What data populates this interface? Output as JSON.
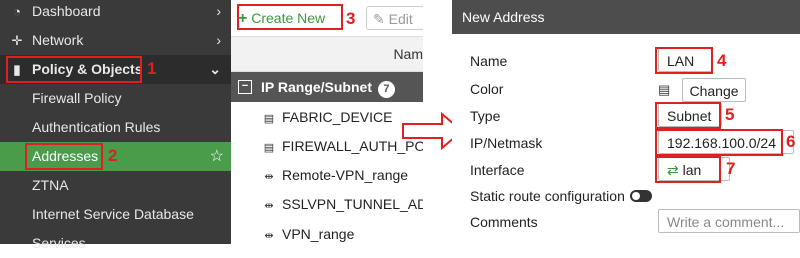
{
  "sidebar": {
    "items": [
      {
        "label": "Dashboard",
        "icon": "dashboard-icon",
        "glyph": "◔",
        "chevron": "›"
      },
      {
        "label": "Network",
        "icon": "network-icon",
        "glyph": "✛",
        "chevron": "›"
      },
      {
        "label": "Policy & Objects",
        "icon": "policy-icon",
        "glyph": "▮",
        "chevron": "⌄"
      },
      {
        "label": "Firewall Policy"
      },
      {
        "label": "Authentication Rules"
      },
      {
        "label": "Addresses",
        "star": "☆"
      },
      {
        "label": "ZTNA"
      },
      {
        "label": "Internet Service Database"
      },
      {
        "label": "Services"
      }
    ]
  },
  "toolbar": {
    "create_plus": "+",
    "create_label": "Create New",
    "edit_glyph": "✎",
    "edit_label": "Edit"
  },
  "table": {
    "name_header": "Nam",
    "group_toggle": "−",
    "group_label": "IP Range/Subnet",
    "group_count": "7",
    "rows": [
      {
        "name": "FABRIC_DEVICE",
        "glyph": "▤"
      },
      {
        "name": "FIREWALL_AUTH_PO",
        "glyph": "▤"
      },
      {
        "name": "Remote-VPN_range",
        "glyph": "⇹"
      },
      {
        "name": "SSLVPN_TUNNEL_AD",
        "glyph": "⇹"
      },
      {
        "name": "VPN_range",
        "glyph": "⇹"
      }
    ]
  },
  "dialog": {
    "title": "New Address",
    "labels": {
      "name": "Name",
      "color": "Color",
      "type": "Type",
      "ip": "IP/Netmask",
      "interface": "Interface",
      "static_route": "Static route configuration",
      "comments": "Comments"
    },
    "values": {
      "name": "LAN",
      "color_glyph": "▤",
      "change_button": "Change",
      "type": "Subnet",
      "ip": "192.168.100.0/24",
      "interface_glyph": "⇄",
      "interface": "lan"
    },
    "comments_placeholder": "Write a comment..."
  },
  "annotations": {
    "step1": "1",
    "step2": "2",
    "step3": "3",
    "step4": "4",
    "step5": "5",
    "step6": "6",
    "step7": "7"
  },
  "colors": {
    "sidebar_bg": "#3a3a3a",
    "active_item": "#4a9c4a",
    "highlight": "#e02020",
    "create_green": "#3a9a3a"
  }
}
